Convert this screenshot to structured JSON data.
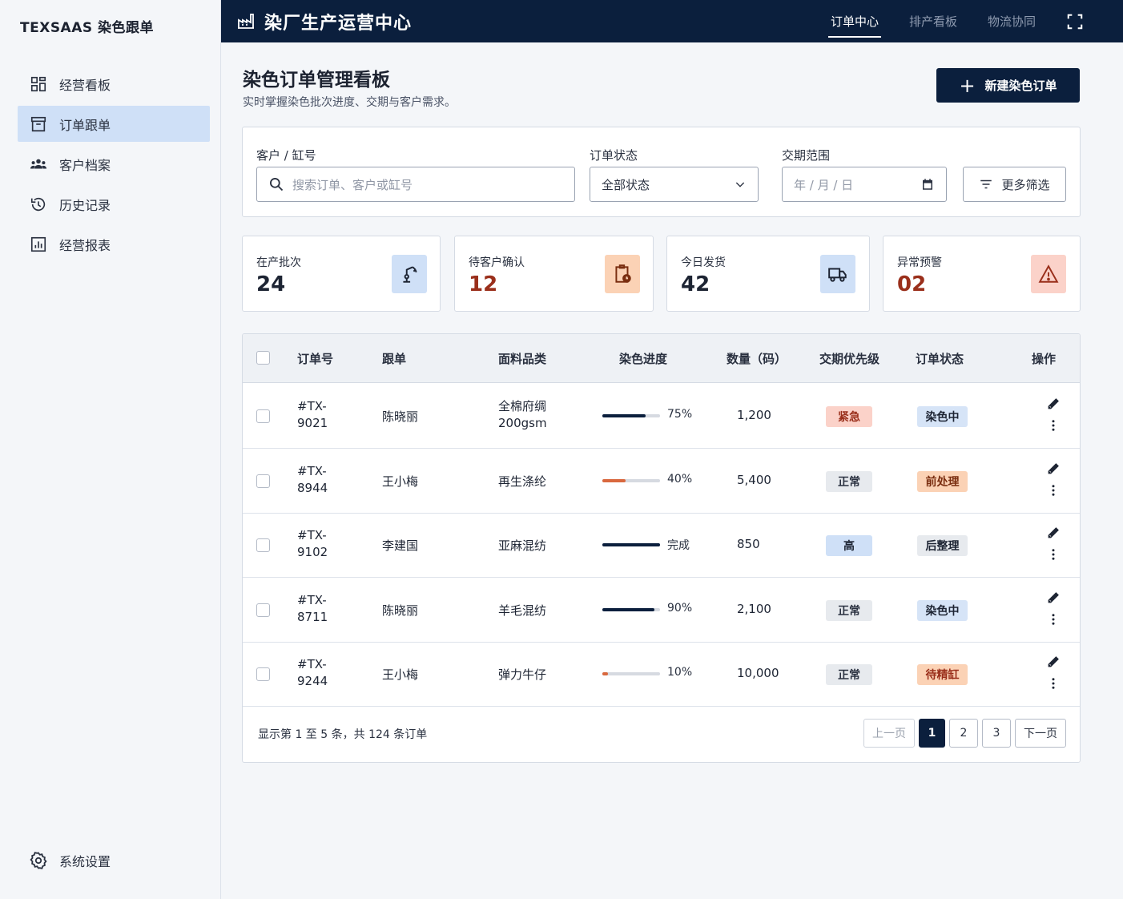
{
  "brand": "TEXSAAS 染色跟单",
  "sidebar": {
    "items": [
      {
        "label": "经营看板",
        "icon": "dashboard-grid-icon",
        "active": false
      },
      {
        "label": "订单跟单",
        "icon": "archive-box-icon",
        "active": true
      },
      {
        "label": "客户档案",
        "icon": "users-group-icon",
        "active": false
      },
      {
        "label": "历史记录",
        "icon": "history-clock-icon",
        "active": false
      },
      {
        "label": "经营报表",
        "icon": "bar-report-icon",
        "active": false
      }
    ],
    "settings_label": "系统设置"
  },
  "header": {
    "title": "染厂生产运营中心",
    "tabs": [
      {
        "label": "订单中心",
        "active": true
      },
      {
        "label": "排产看板",
        "active": false
      },
      {
        "label": "物流协同",
        "active": false
      }
    ]
  },
  "main": {
    "title": "染色订单管理看板",
    "subtitle": "实时掌握染色批次进度、交期与客户需求。",
    "new_button": "新建染色订单"
  },
  "filters": {
    "search_label": "客户 / 缸号",
    "search_placeholder": "搜索订单、客户或缸号",
    "status_label": "订单状态",
    "status_value": "全部状态",
    "date_label": "交期范围",
    "date_placeholder": "年 / 月 / 日",
    "more_label": "更多筛选"
  },
  "stats": [
    {
      "label": "在产批次",
      "value": "24",
      "color": "#1d2433",
      "icon": "robot-arm-icon",
      "icon_bg": "#cfe0f7"
    },
    {
      "label": "待客户确认",
      "value": "12",
      "color": "#9a2f1b",
      "icon": "clipboard-clock-icon",
      "icon_bg": "#fbd2b5"
    },
    {
      "label": "今日发货",
      "value": "42",
      "color": "#1d2433",
      "icon": "truck-icon",
      "icon_bg": "#cfe0f7"
    },
    {
      "label": "异常预警",
      "value": "02",
      "color": "#9a2f1b",
      "icon": "warning-triangle-icon",
      "icon_bg": "#fbd2c9"
    }
  ],
  "table": {
    "columns": [
      "订单号",
      "跟单",
      "面料品类",
      "染色进度",
      "数量（码）",
      "交期优先级",
      "订单状态",
      "操作"
    ],
    "rows": [
      {
        "order_a": "#TX-",
        "order_b": "9021",
        "owner": "陈晓丽",
        "fabric_a": "全棉府绸",
        "fabric_b": "200gsm",
        "progress": 0.75,
        "progress_label": "75%",
        "progress_color": "#0b1f3d",
        "qty": "1,200",
        "priority": "紧急",
        "priority_bg": "#fbd2c9",
        "priority_fg": "#9a2f1b",
        "status": "染色中",
        "status_bg": "#d6e4f7",
        "status_fg": "#1d2433"
      },
      {
        "order_a": "#TX-",
        "order_b": "8944",
        "owner": "王小梅",
        "fabric_a": "再生涤纶",
        "fabric_b": "",
        "progress": 0.4,
        "progress_label": "40%",
        "progress_color": "#d9683e",
        "qty": "5,400",
        "priority": "正常",
        "priority_bg": "#e7eaee",
        "priority_fg": "#2a3140",
        "status": "前处理",
        "status_bg": "#fbd2b5",
        "status_fg": "#7a2e10"
      },
      {
        "order_a": "#TX-",
        "order_b": "9102",
        "owner": "李建国",
        "fabric_a": "亚麻混纺",
        "fabric_b": "",
        "progress": 1.0,
        "progress_label": "完成",
        "progress_color": "#0b1f3d",
        "qty": "850",
        "priority": "高",
        "priority_bg": "#cfe0f7",
        "priority_fg": "#1d2433",
        "status": "后整理",
        "status_bg": "#e7eaee",
        "status_fg": "#1d2433"
      },
      {
        "order_a": "#TX-",
        "order_b": "8711",
        "owner": "陈晓丽",
        "fabric_a": "羊毛混纺",
        "fabric_b": "",
        "progress": 0.9,
        "progress_label": "90%",
        "progress_color": "#0b1f3d",
        "qty": "2,100",
        "priority": "正常",
        "priority_bg": "#e7eaee",
        "priority_fg": "#2a3140",
        "status": "染色中",
        "status_bg": "#d6e4f7",
        "status_fg": "#1d2433"
      },
      {
        "order_a": "#TX-",
        "order_b": "9244",
        "owner": "王小梅",
        "fabric_a": "弹力牛仔",
        "fabric_b": "",
        "progress": 0.1,
        "progress_label": "10%",
        "progress_color": "#d9683e",
        "qty": "10,000",
        "priority": "正常",
        "priority_bg": "#e7eaee",
        "priority_fg": "#2a3140",
        "status": "待精缸",
        "status_bg": "#fbd2b5",
        "status_fg": "#9a2f1b"
      }
    ],
    "summary": "显示第 1 至 5 条，共 124 条订单",
    "pagination": {
      "prev": "上一页",
      "pages": [
        "1",
        "2",
        "3"
      ],
      "current": "1",
      "next": "下一页"
    }
  }
}
